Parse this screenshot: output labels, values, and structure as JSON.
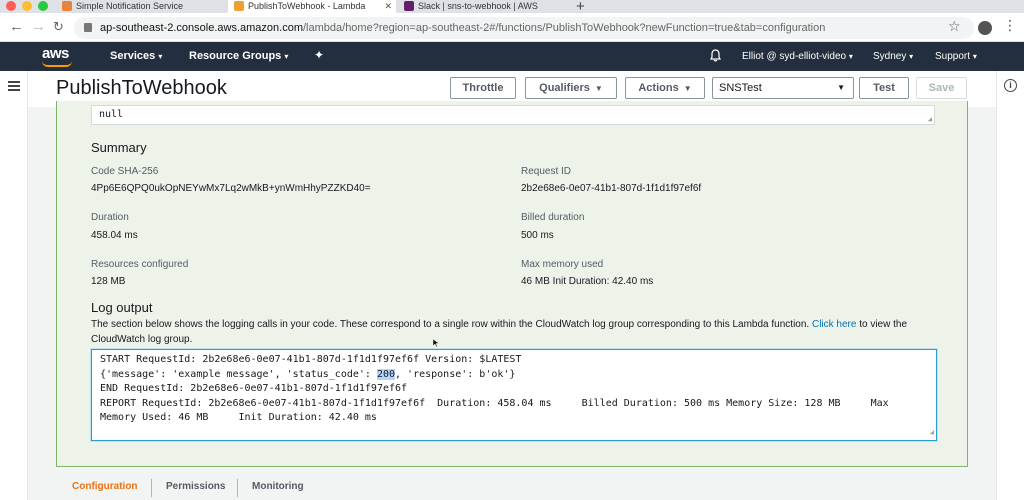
{
  "browser": {
    "tabs": [
      {
        "title": "Simple Notification Service",
        "active": false
      },
      {
        "title": "PublishToWebhook - Lambda",
        "active": true
      },
      {
        "title": "Slack | sns-to-webhook | AWS",
        "active": false
      }
    ],
    "url_host": "ap-southeast-2.console.aws.amazon.com",
    "url_path": "/lambda/home?region=ap-southeast-2#/functions/PublishToWebhook?newFunction=true&tab=configuration"
  },
  "awsnav": {
    "logo": "aws",
    "services": "Services",
    "resource_groups": "Resource Groups",
    "user": "Elliot @ syd-elliot-video",
    "region": "Sydney",
    "support": "Support"
  },
  "header": {
    "title": "PublishToWebhook",
    "throttle": "Throttle",
    "qualifiers": "Qualifiers",
    "actions": "Actions",
    "test_event": "SNSTest",
    "test": "Test",
    "save": "Save"
  },
  "result": {
    "null_text": "null"
  },
  "summary": {
    "title": "Summary",
    "code_sha_label": "Code SHA-256",
    "code_sha_value": "4Pp6E6QPQ0ukOpNEYwMx7Lq2wMkB+ynWmHhyPZZKD40=",
    "request_id_label": "Request ID",
    "request_id_value": "2b2e68e6-0e07-41b1-807d-1f1d1f97ef6f",
    "duration_label": "Duration",
    "duration_value": "458.04 ms",
    "billed_label": "Billed duration",
    "billed_value": "500 ms",
    "resources_label": "Resources configured",
    "resources_value": "128 MB",
    "maxmem_label": "Max memory used",
    "maxmem_value": "46 MB Init Duration: 42.40 ms"
  },
  "log": {
    "title": "Log output",
    "desc_before": "The section below shows the logging calls in your code. These correspond to a single row within the CloudWatch log group corresponding to this Lambda function. ",
    "desc_link": "Click here",
    "desc_after": " to view the CloudWatch log group.",
    "line1": "START RequestId: 2b2e68e6-0e07-41b1-807d-1f1d1f97ef6f Version: $LATEST",
    "line2_before": "{'message': 'example message', 'status_code': ",
    "line2_hl": "200",
    "line2_after": ", 'response': b'ok'}",
    "line3": "END RequestId: 2b2e68e6-0e07-41b1-807d-1f1d1f97ef6f",
    "line4": "REPORT RequestId: 2b2e68e6-0e07-41b1-807d-1f1d1f97ef6f  Duration: 458.04 ms     Billed Duration: 500 ms Memory Size: 128 MB     Max Memory Used: 46 MB     Init Duration: 42.40 ms"
  },
  "bottom_tabs": {
    "configuration": "Configuration",
    "permissions": "Permissions",
    "monitoring": "Monitoring"
  },
  "colors": {
    "aws_nav": "#232f3e",
    "aws_orange": "#ff9900",
    "success_green": "#7fb46b",
    "link_blue": "#0073bb",
    "active_tab": "#ec7211"
  }
}
